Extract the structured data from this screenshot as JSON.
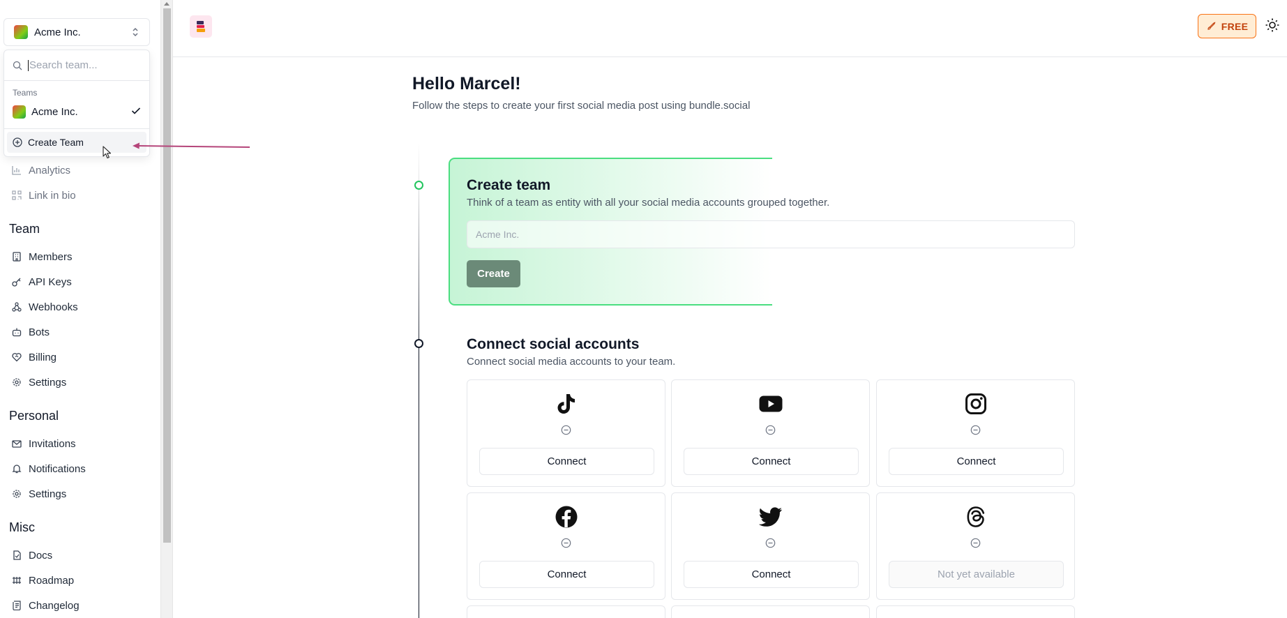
{
  "sidebar": {
    "team_switcher": {
      "team_name": "Acme Inc."
    },
    "dropdown": {
      "search_placeholder": "Search team...",
      "section_label": "Teams",
      "teams": [
        {
          "name": "Acme Inc.",
          "selected": true
        }
      ],
      "create_label": "Create Team"
    },
    "nav_partial": [
      {
        "label": "Analytics",
        "icon": "bar-chart-icon"
      },
      {
        "label": "Link in bio",
        "icon": "qr-code-icon"
      }
    ],
    "team_section": {
      "title": "Team",
      "items": [
        {
          "label": "Members",
          "icon": "building-icon"
        },
        {
          "label": "API Keys",
          "icon": "key-icon"
        },
        {
          "label": "Webhooks",
          "icon": "webhook-icon"
        },
        {
          "label": "Bots",
          "icon": "bot-icon"
        },
        {
          "label": "Billing",
          "icon": "heart-handshake-icon"
        },
        {
          "label": "Settings",
          "icon": "gear-icon"
        }
      ]
    },
    "personal_section": {
      "title": "Personal",
      "items": [
        {
          "label": "Invitations",
          "icon": "mail-icon"
        },
        {
          "label": "Notifications",
          "icon": "bell-icon"
        },
        {
          "label": "Settings",
          "icon": "gear-icon"
        }
      ]
    },
    "misc_section": {
      "title": "Misc",
      "items": [
        {
          "label": "Docs",
          "icon": "file-icon"
        },
        {
          "label": "Roadmap",
          "icon": "roadmap-icon"
        },
        {
          "label": "Changelog",
          "icon": "scroll-icon"
        }
      ]
    }
  },
  "header": {
    "plan_badge": "FREE",
    "colors": {
      "badge_border": "#f97316",
      "badge_bg": "#ffedd5",
      "badge_text": "#c2410c"
    }
  },
  "main": {
    "greeting": "Hello Marcel!",
    "greeting_sub": "Follow the steps to create your first social media post using bundle.social",
    "create_team": {
      "title": "Create team",
      "subtitle": "Think of a team as entity with all your social media accounts grouped together.",
      "input_placeholder": "Acme Inc.",
      "button": "Create"
    },
    "connect": {
      "title": "Connect social accounts",
      "subtitle": "Connect social media accounts to your team.",
      "tiles": [
        {
          "platform": "tiktok-icon",
          "button": "Connect",
          "available": true
        },
        {
          "platform": "youtube-icon",
          "button": "Connect",
          "available": true
        },
        {
          "platform": "instagram-icon",
          "button": "Connect",
          "available": true
        },
        {
          "platform": "facebook-icon",
          "button": "Connect",
          "available": true
        },
        {
          "platform": "twitter-icon",
          "button": "Connect",
          "available": true
        },
        {
          "platform": "threads-icon",
          "button": "Not yet available",
          "available": false
        }
      ]
    }
  },
  "colors": {
    "accent_green": "#22c55e",
    "annotation_arrow": "#b5457a"
  }
}
